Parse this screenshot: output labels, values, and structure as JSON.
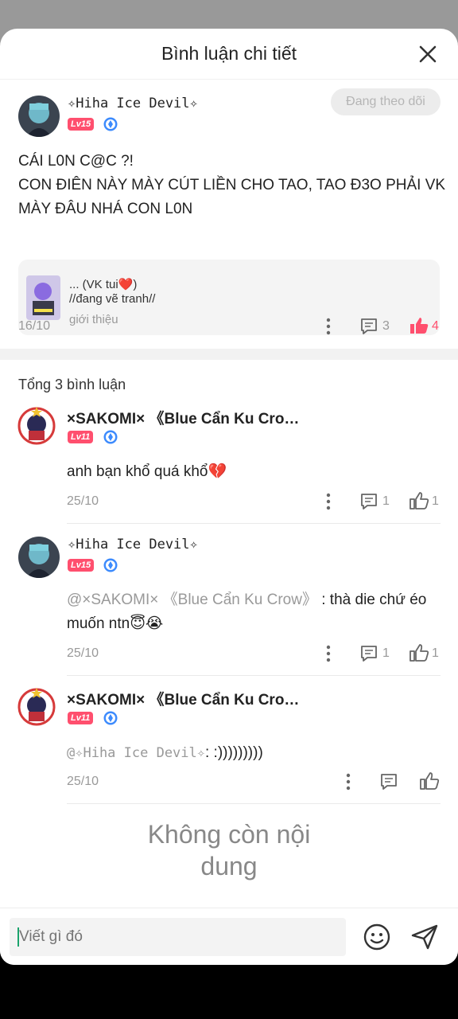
{
  "header": {
    "title": "Bình luận chi tiết"
  },
  "post": {
    "author": "✧Hiha Ice Devil✧",
    "level": "Lv15",
    "follow_label": "Đang theo dõi",
    "body_line1": "CÁI L0N C@C ?!",
    "body_line2": "CON ĐIÊN NÀY MÀY CÚT LIỀN CHO TAO, TAO Đ3O PHẢI VK MÀY ĐÂU NHÁ CON L0N",
    "quote_line1": "... (VK tui❤️)",
    "quote_line2": "//đang vẽ tranh//",
    "quote_line3": "giới thiệu",
    "date": "16/10",
    "comment_count": "3",
    "like_count": "4"
  },
  "total_label": "Tổng 3 bình luận",
  "comments": [
    {
      "author": "×SAKOMI× 《Blue Cẩn Ku Cro…",
      "level": "Lv11",
      "text": "anh bạn khổ quá khổ💔",
      "date": "25/10",
      "reply_count": "1",
      "like_count": "1"
    },
    {
      "author": "✧Hiha Ice Devil✧",
      "level": "Lv15",
      "mention": "@×SAKOMI× 《Blue Cẩn Ku Crow》",
      "text": ": thà die chứ éo muốn ntn😇😭",
      "date": "25/10",
      "reply_count": "1",
      "like_count": "1"
    },
    {
      "author": "×SAKOMI× 《Blue Cẩn Ku Cro…",
      "level": "Lv11",
      "mention": "@✧Hiha Ice Devil✧",
      "text": ": :)))))))))",
      "date": "25/10"
    }
  ],
  "no_more": "Không còn nội dung",
  "composer": {
    "placeholder": "Viết gì đó"
  },
  "colors": {
    "accent_red": "#ff4f6e",
    "verify_blue": "#3d8bfd",
    "muted": "#999999"
  }
}
